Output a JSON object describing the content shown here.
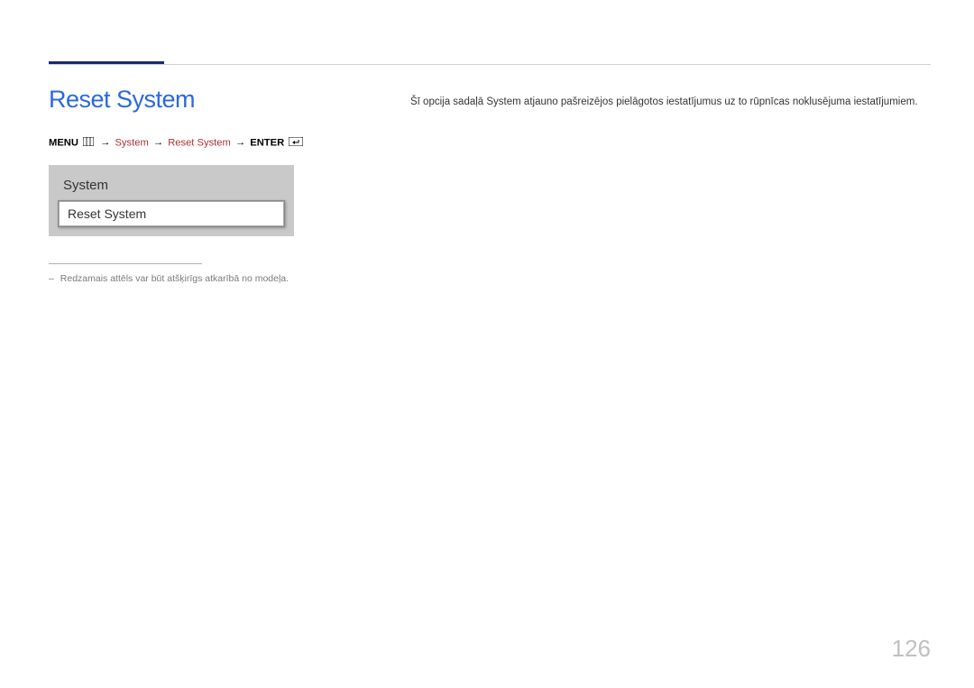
{
  "page": {
    "title": "Reset System",
    "number": "126"
  },
  "breadcrumb": {
    "menu_label": "MENU",
    "path1": "System",
    "path2": "Reset System",
    "enter_label": "ENTER",
    "arrow": "→"
  },
  "preview": {
    "panel_title": "System",
    "item_label": "Reset System"
  },
  "footnote": {
    "text": "Redzamais attēls var būt atšķirīgs atkarībā no modeļa."
  },
  "description": {
    "text": "Šī opcija sadaļā System atjauno pašreizējos pielāgotos iestatījumus uz to rūpnīcas noklusējuma iestatījumiem."
  }
}
